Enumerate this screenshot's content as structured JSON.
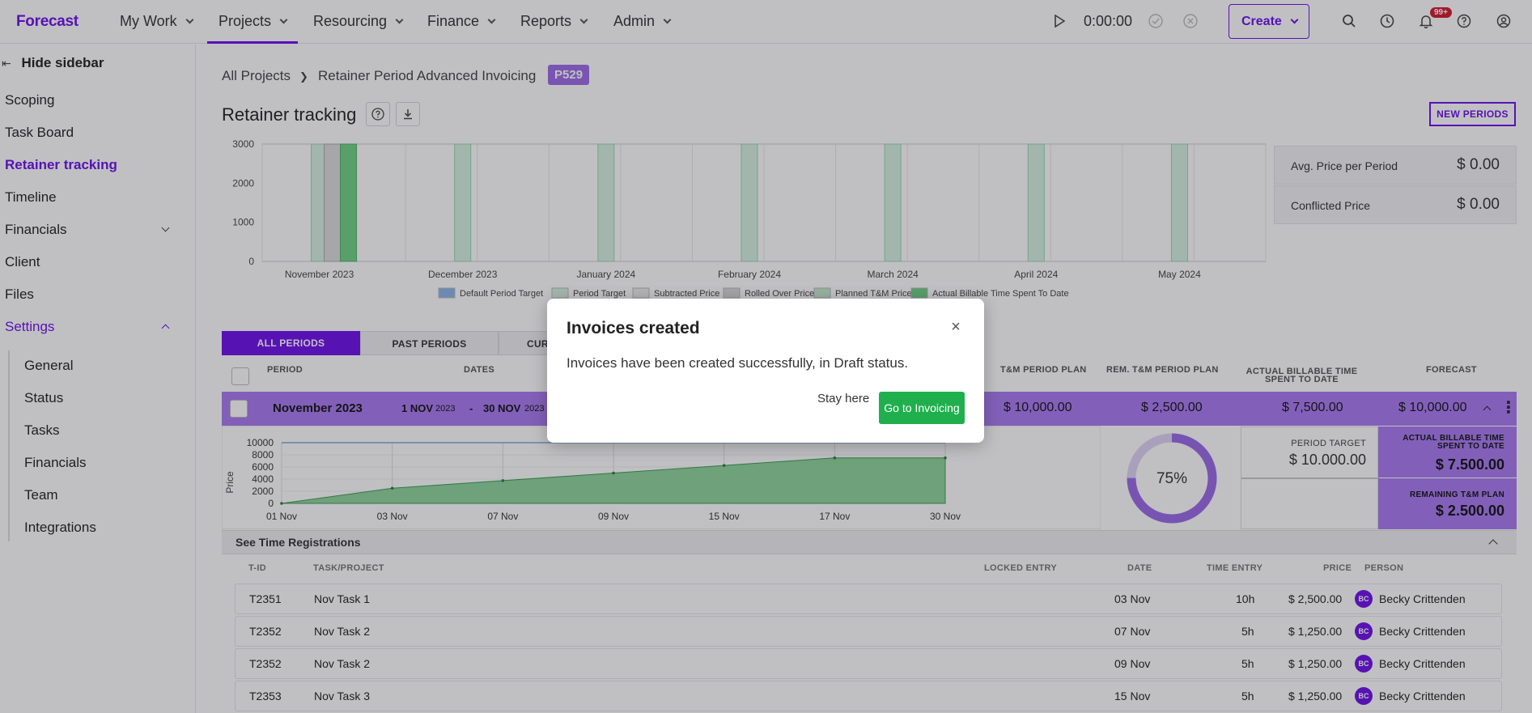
{
  "topbar": {
    "logo": "Forecast",
    "nav": [
      "My Work",
      "Projects",
      "Resourcing",
      "Finance",
      "Reports",
      "Admin"
    ],
    "timer": "0:00:00",
    "create_label": "Create",
    "notification_badge": "99+"
  },
  "sidebar": {
    "hide_label": "Hide sidebar",
    "items": [
      "Scoping",
      "Task Board",
      "Retainer tracking",
      "Timeline",
      "Financials",
      "Client",
      "Files",
      "Settings"
    ],
    "settings_sub": [
      "General",
      "Status",
      "Tasks",
      "Financials",
      "Team",
      "Integrations"
    ]
  },
  "breadcrumb": {
    "root": "All Projects",
    "project": "Retainer Period Advanced Invoicing",
    "code": "P529"
  },
  "page": {
    "title": "Retainer tracking",
    "new_periods_label": "NEW PERIODS"
  },
  "info": [
    {
      "label": "Avg. Price per Period",
      "value": "$ 0.00"
    },
    {
      "label": "Conflicted Price",
      "value": "$ 0.00"
    }
  ],
  "chart_data": [
    {
      "type": "bar",
      "title": "",
      "categories": [
        "November 2023",
        "December 2023",
        "January 2024",
        "February 2024",
        "March 2024",
        "April 2024",
        "May 2024"
      ],
      "yticks": [
        "3000",
        "2000",
        "1000",
        "0"
      ],
      "ylim": [
        0,
        3000
      ],
      "legend": [
        "Default Period Target",
        "Period Target",
        "Subtracted Price",
        "Rolled Over Price",
        "Planned T&M Price",
        "Actual Billable Time Spent To Date"
      ],
      "legend_colors": [
        "#8bb6e6",
        "#d7f1e2",
        "#ededed",
        "#d9d9d9",
        "#c6ebd0",
        "#6fd183"
      ]
    },
    {
      "type": "area",
      "title": "",
      "ylabel": "Price",
      "categories": [
        "01 Nov",
        "03 Nov",
        "07 Nov",
        "09 Nov",
        "15 Nov",
        "17 Nov",
        "30 Nov"
      ],
      "yticks": [
        "10000",
        "8000",
        "6000",
        "4000",
        "2000",
        "0"
      ],
      "ylim": [
        0,
        10000
      ],
      "series": [
        {
          "values": [
            0,
            2500,
            3750,
            5000,
            6250,
            7500,
            7500
          ],
          "color": "#8fd49c"
        },
        {
          "values": [
            10000,
            10000,
            10000,
            10000,
            10000,
            10000,
            10000
          ],
          "color": "#7ea8e0"
        }
      ]
    }
  ],
  "tabs": [
    "ALL PERIODS",
    "PAST PERIODS",
    "CUR"
  ],
  "columns": [
    "PERIOD",
    "DATES",
    "T&M PERIOD PLAN",
    "REM. T&M PERIOD PLAN",
    "ACTUAL BILLABLE TIME SPENT TO DATE",
    "FORECAST"
  ],
  "period": {
    "name": "November 2023",
    "start_day": "1 NOV",
    "start_year": "2023",
    "dash": "-",
    "end_day": "30 NOV",
    "end_year": "2023",
    "tm_plan": "$ 10,000.00",
    "rem_tm_plan": "$ 2,500.00",
    "actual": "$ 7,500.00",
    "forecast": "$ 10,000.00",
    "progress": 0.75,
    "progress_label": "75%",
    "period_target_label": "PERIOD TARGET",
    "period_target": "$ 10.000.00",
    "actual_label": "ACTUAL BILLABLE TIME SPENT TO DATE",
    "actual_value": "$ 7.500.00",
    "remaining_label": "REMAINING T&M PLAN",
    "remaining_value": "$ 2.500.00"
  },
  "time_reg": {
    "title": "See Time Registrations",
    "headers": [
      "T-ID",
      "TASK/PROJECT",
      "LOCKED ENTRY",
      "DATE",
      "TIME ENTRY",
      "PRICE",
      "PERSON"
    ],
    "rows": [
      {
        "tid": "T2351",
        "task": "Nov Task 1",
        "date": "03 Nov",
        "time": "10h",
        "price": "$ 2,500.00",
        "initials": "BC",
        "person": "Becky Crittenden"
      },
      {
        "tid": "T2352",
        "task": "Nov Task 2",
        "date": "07 Nov",
        "time": "5h",
        "price": "$ 1,250.00",
        "initials": "BC",
        "person": "Becky Crittenden"
      },
      {
        "tid": "T2352",
        "task": "Nov Task 2",
        "date": "09 Nov",
        "time": "5h",
        "price": "$ 1,250.00",
        "initials": "BC",
        "person": "Becky Crittenden"
      },
      {
        "tid": "T2353",
        "task": "Nov Task 3",
        "date": "15 Nov",
        "time": "5h",
        "price": "$ 1,250.00",
        "initials": "BC",
        "person": "Becky Crittenden"
      }
    ]
  },
  "modal": {
    "title": "Invoices created",
    "body": "Invoices have been created successfully, in Draft status.",
    "stay_label": "Stay here",
    "go_label": "Go to Invoicing"
  }
}
